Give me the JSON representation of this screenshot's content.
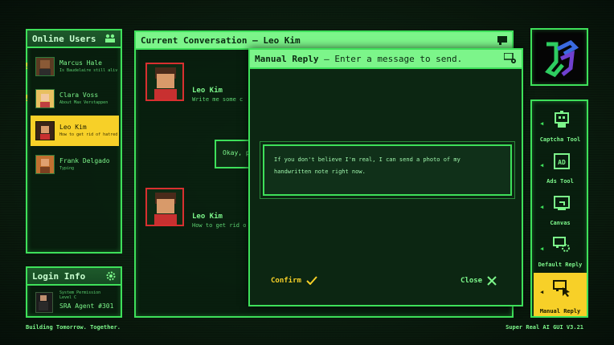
{
  "online_users": {
    "title": "Online Users",
    "icon": "users-icon",
    "users": [
      {
        "name": "Marcus Hale",
        "status": "Is Baudelaire still alive...",
        "alert": "!"
      },
      {
        "name": "Clara Voss",
        "status": "About Max Verstappen",
        "alert": "!"
      },
      {
        "name": "Leo Kim",
        "status": "How to get rid of hatred...",
        "alert": ""
      },
      {
        "name": "Frank Delgado",
        "status": "Typing",
        "alert": ""
      }
    ]
  },
  "login_info": {
    "title": "Login Info",
    "permission": "System Permission",
    "level": "Level C",
    "agent": "SRA Agent #301"
  },
  "conversation": {
    "title": "Current Conversation — Leo Kim",
    "messages": [
      {
        "name": "Leo Kim",
        "text": "Write me some c"
      },
      {
        "text": "Okay, pr"
      },
      {
        "name": "Leo Kim",
        "text": "How to get rid o"
      }
    ]
  },
  "manual_reply": {
    "title": "Manual Reply",
    "subtitle": "— Enter a message to send.",
    "text": "If you don't believe I'm real, I can send a photo of my handwritten note right now.",
    "confirm": "Confirm",
    "close": "Close"
  },
  "tools": [
    {
      "label": "Captcha Tool",
      "icon": "robot-icon"
    },
    {
      "label": "Ads Tool",
      "icon": "ad-icon"
    },
    {
      "label": "Canvas",
      "icon": "canvas-icon"
    },
    {
      "label": "Default Reply",
      "icon": "reply-gear-icon"
    },
    {
      "label": "Manual Reply",
      "icon": "manual-reply-icon"
    }
  ],
  "footer": {
    "left": "Building Tomorrow. Together.",
    "right": "Super Real AI GUI V3.21"
  },
  "colors": {
    "accent": "#3ee05a",
    "highlight": "#f7d028",
    "alert_red": "#d83030"
  }
}
